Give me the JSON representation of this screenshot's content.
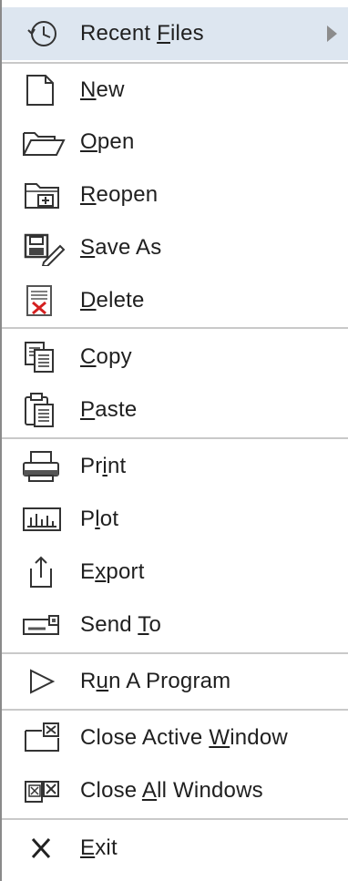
{
  "menu": {
    "items": [
      {
        "id": "recent",
        "pre": "Recent ",
        "acc": "F",
        "post": "iles",
        "icon": "clock-arrow-icon"
      },
      {
        "id": "new",
        "pre": "",
        "acc": "N",
        "post": "ew",
        "icon": "new-file-icon"
      },
      {
        "id": "open",
        "pre": "",
        "acc": "O",
        "post": "pen",
        "icon": "folder-open-icon"
      },
      {
        "id": "reopen",
        "pre": "",
        "acc": "R",
        "post": "eopen",
        "icon": "folder-plus-icon"
      },
      {
        "id": "saveas",
        "pre": "",
        "acc": "S",
        "post": "ave As",
        "icon": "save-as-icon"
      },
      {
        "id": "delete",
        "pre": "",
        "acc": "D",
        "post": "elete",
        "icon": "delete-doc-icon"
      },
      {
        "id": "copy",
        "pre": "",
        "acc": "C",
        "post": "opy",
        "icon": "copy-icon"
      },
      {
        "id": "paste",
        "pre": "",
        "acc": "P",
        "post": "aste",
        "icon": "paste-icon"
      },
      {
        "id": "print",
        "pre": "Pr",
        "acc": "i",
        "post": "nt",
        "icon": "printer-icon"
      },
      {
        "id": "plot",
        "pre": "P",
        "acc": "l",
        "post": "ot",
        "icon": "plot-icon"
      },
      {
        "id": "export",
        "pre": "E",
        "acc": "x",
        "post": "port",
        "icon": "export-icon"
      },
      {
        "id": "sendto",
        "pre": "Send ",
        "acc": "T",
        "post": "o",
        "icon": "send-mail-icon"
      },
      {
        "id": "run",
        "pre": "R",
        "acc": "u",
        "post": "n A Program",
        "icon": "run-triangle-icon"
      },
      {
        "id": "closeactive",
        "pre": "Close Active ",
        "acc": "W",
        "post": "indow",
        "icon": "close-window-icon"
      },
      {
        "id": "closeall",
        "pre": "Close ",
        "acc": "A",
        "post": "ll Windows",
        "icon": "close-all-windows-icon"
      },
      {
        "id": "exit",
        "pre": "",
        "acc": "E",
        "post": "xit",
        "icon": "exit-x-icon"
      }
    ]
  },
  "colors": {
    "highlight": "#dde6f0",
    "separator": "#c9c9c9",
    "delete_red": "#d42020",
    "text": "#1f1f1f"
  }
}
